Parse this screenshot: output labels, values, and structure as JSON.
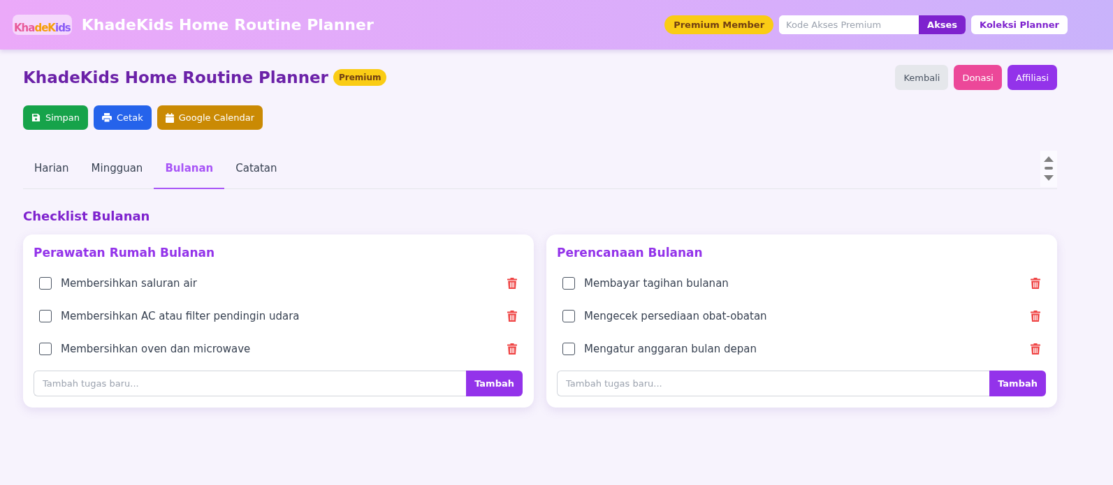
{
  "header": {
    "logo_text": "KhadeKids",
    "title": "KhadeKids Home Routine Planner",
    "badge": "Premium Member",
    "access_field": {
      "placeholder": "Kode Akses Premium"
    },
    "access_button": "Akses",
    "collection_button": "Koleksi Planner"
  },
  "page": {
    "title": "KhadeKids Home Routine Planner",
    "badge": "Premium",
    "nav_buttons": [
      {
        "label": "Kembali",
        "color": "#e5e7eb"
      },
      {
        "label": "Donasi",
        "color": "#ec4899"
      },
      {
        "label": "Affiliasi",
        "color": "#9333ea"
      }
    ],
    "actions": [
      {
        "label": "Simpan",
        "kind": "save",
        "color": "#16a34a"
      },
      {
        "label": "Cetak",
        "kind": "print",
        "color": "#2563eb"
      },
      {
        "label": "Google Calendar",
        "kind": "calendar",
        "color": "#ca8a04"
      }
    ]
  },
  "tabs": [
    {
      "label": "Harian",
      "selected": false
    },
    {
      "label": "Mingguan",
      "selected": false
    },
    {
      "label": "Bulanan",
      "selected": true
    },
    {
      "label": "Catatan",
      "selected": false
    }
  ],
  "section_title": "Checklist Bulanan",
  "cards": [
    {
      "title": "Perawatan Rumah Bulanan",
      "items": [
        {
          "text": "Membersihkan saluran air",
          "checked": false
        },
        {
          "text": "Membersihkan AC atau filter pendingin udara",
          "checked": false
        },
        {
          "text": "Membersihkan oven dan microwave",
          "checked": false
        }
      ],
      "input": {
        "placeholder": "Tambah tugas baru..."
      },
      "add_button": "Tambah"
    },
    {
      "title": "Perencanaan Bulanan",
      "items": [
        {
          "text": "Membayar tagihan bulanan",
          "checked": false
        },
        {
          "text": "Mengecek persediaan obat-obatan",
          "checked": false
        },
        {
          "text": "Mengatur anggaran bulan depan",
          "checked": false
        }
      ],
      "input": {
        "placeholder": "Tambah tugas baru..."
      },
      "add_button": "Tambah"
    }
  ]
}
